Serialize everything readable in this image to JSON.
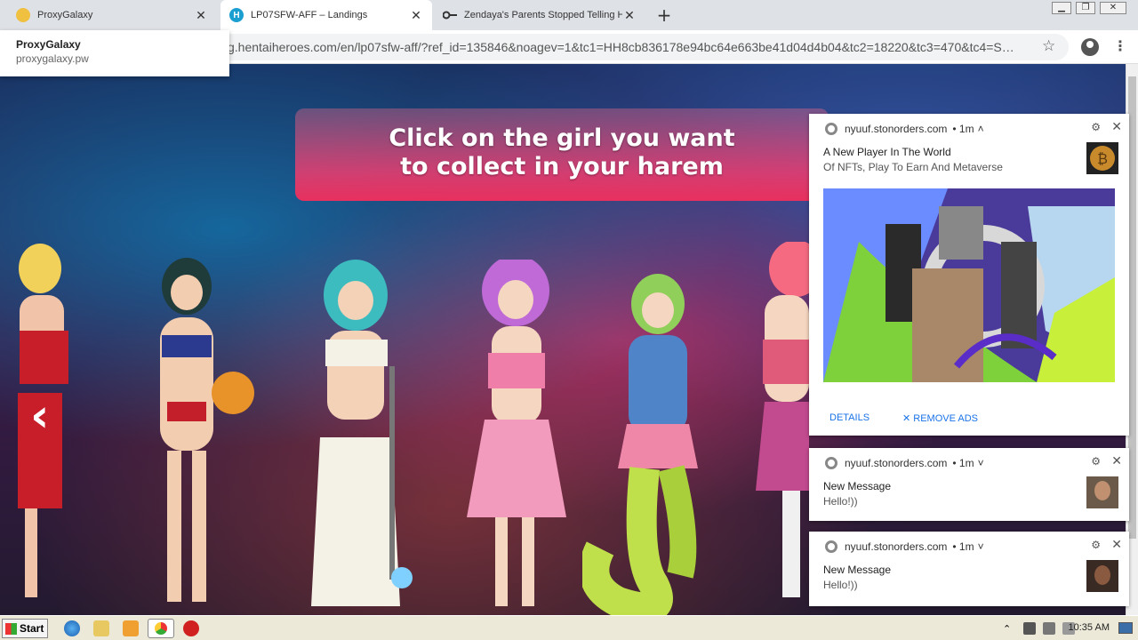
{
  "browser": {
    "tabs": [
      {
        "title": "ProxyGalaxy",
        "close": "✕"
      },
      {
        "title": "LP07SFW-AFF – Landings",
        "close": "✕"
      },
      {
        "title": "Zendaya's Parents Stopped Telling H",
        "close": "✕"
      }
    ],
    "new_tab": "+",
    "url": "g.hentaiheroes.com/en/lp07sfw-aff/?ref_id=135846&noagev=1&tc1=HH8cb836178e94bc64e663be41d04d4b04&tc2=18220&tc3=470&tc4=S…",
    "star": "☆",
    "menu": "⋮",
    "hover_card": {
      "title": "ProxyGalaxy",
      "url": "proxygalaxy.pw"
    },
    "window_controls": [
      "▁",
      "❐",
      "✕"
    ]
  },
  "page": {
    "banner_line1": "Click on the girl you want",
    "banner_line2": "to collect in your harem",
    "prev_arrow": "‹"
  },
  "notifications": [
    {
      "site": "nyuuf.stonorders.com",
      "time": "• 1m",
      "chevron": "˄",
      "title": "A New Player In The World",
      "body": "Of NFTs, Play To Earn And Metaverse",
      "details": "DETAILS",
      "remove_ads": "✕ REMOVE ADS",
      "gear": "⚙",
      "close": "✕"
    },
    {
      "site": "nyuuf.stonorders.com",
      "time": "• 1m",
      "chevron": "˅",
      "title": "New Message",
      "body": "Hello!))",
      "gear": "⚙",
      "close": "✕"
    },
    {
      "site": "nyuuf.stonorders.com",
      "time": "• 1m",
      "chevron": "˅",
      "title": "New Message",
      "body": "Hello!))",
      "gear": "⚙",
      "close": "✕"
    }
  ],
  "taskbar": {
    "start_label": "Start",
    "clock": "10:35 AM"
  },
  "colors": {
    "banner_pink": "#e8305e",
    "link_blue": "#1a73e8",
    "taskbar": "#ece9d8"
  }
}
